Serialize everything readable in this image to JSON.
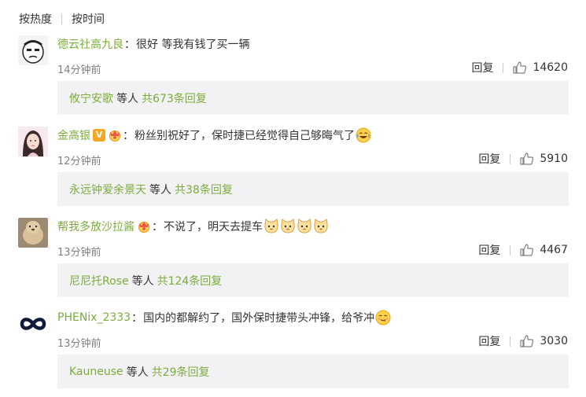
{
  "sort": {
    "hot": "按热度",
    "time": "按时间"
  },
  "comments": [
    {
      "username": "德云社高九良",
      "text": "很好 等我有钱了买一辆",
      "time": "14分钟前",
      "reply": "回复",
      "likes": "14620",
      "sub_users": "攸宁安歌",
      "sub_deng": "等人",
      "sub_total": "共673条回复"
    },
    {
      "username": "金高银",
      "text": "粉丝别祝好了，保时捷已经觉得自己够晦气了",
      "time": "12分钟前",
      "reply": "回复",
      "likes": "5910",
      "sub_users": "永远钟爱余景天",
      "sub_deng": "等人",
      "sub_total": "共38条回复"
    },
    {
      "username": "帮我多放沙拉酱",
      "text": "不说了，明天去提车",
      "time": "13分钟前",
      "reply": "回复",
      "likes": "4467",
      "sub_users": "尼尼托Rose",
      "sub_deng": "等人",
      "sub_total": "共124条回复"
    },
    {
      "username": "PHENix_2333",
      "text": "国内的都解约了，国外保时捷带头冲锋，给爷冲",
      "time": "13分钟前",
      "reply": "回复",
      "likes": "3030",
      "sub_users": "Kauneuse",
      "sub_deng": "等人",
      "sub_total": "共29条回复"
    }
  ],
  "colors": {
    "username": "#7cac3c",
    "text": "#333333",
    "time": "#808080",
    "subbox": "#f2f2f5"
  },
  "icons": [
    "thumbs-up-icon",
    "vip-v-badge",
    "crown-badge",
    "laughing-emoji",
    "cat-emoji",
    "yum-emoji"
  ]
}
